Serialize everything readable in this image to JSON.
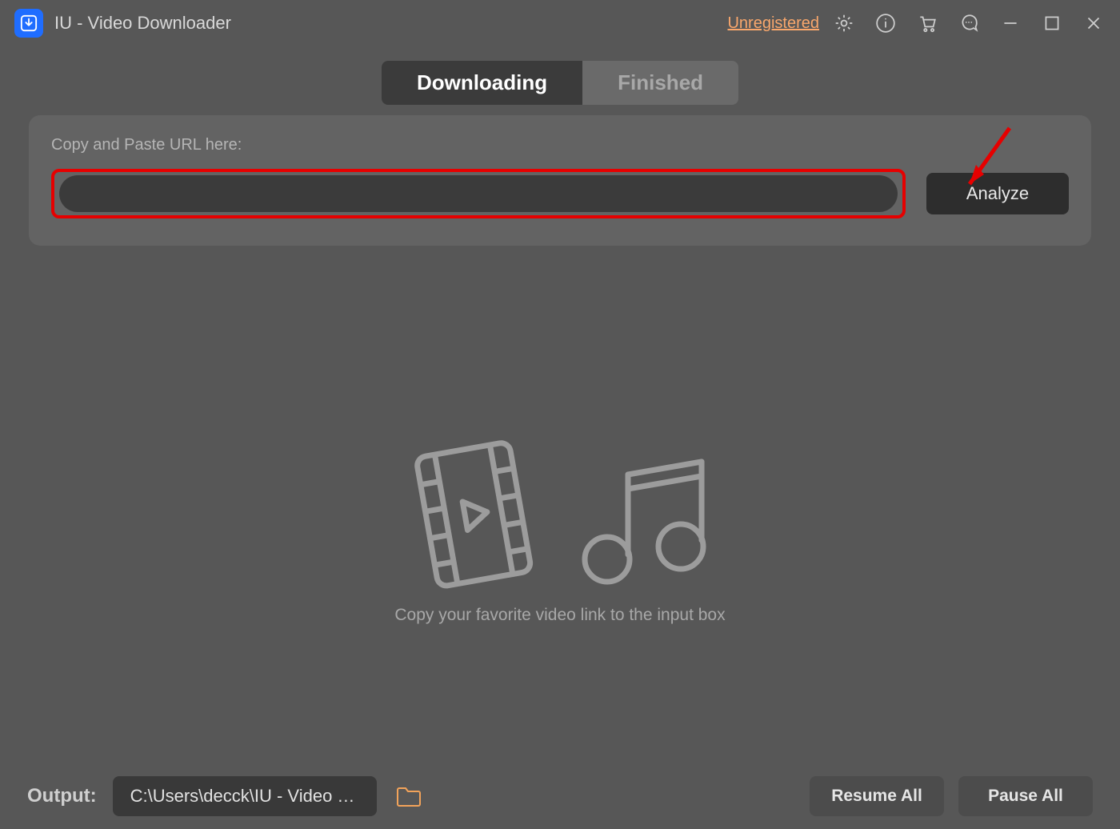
{
  "titlebar": {
    "app_title": "IU - Video Downloader",
    "unregistered": "Unregistered"
  },
  "tabs": {
    "downloading": "Downloading",
    "finished": "Finished",
    "active": "downloading"
  },
  "url_panel": {
    "label": "Copy and Paste URL here:",
    "input_value": "",
    "analyze_button": "Analyze"
  },
  "empty_state": {
    "hint": "Copy your favorite video link to the input box"
  },
  "footer": {
    "output_label": "Output:",
    "output_path": "C:\\Users\\decck\\IU - Video D...",
    "resume_all": "Resume All",
    "pause_all": "Pause All"
  },
  "icons": {
    "settings": "gear-icon",
    "info": "info-icon",
    "shop": "cart-icon",
    "feedback": "chat-icon",
    "minimize": "minimize-icon",
    "maximize": "maximize-icon",
    "close": "close-icon"
  },
  "colors": {
    "accent_link": "#f9a76c",
    "highlight": "#e60000",
    "app_icon": "#1f6dff"
  }
}
